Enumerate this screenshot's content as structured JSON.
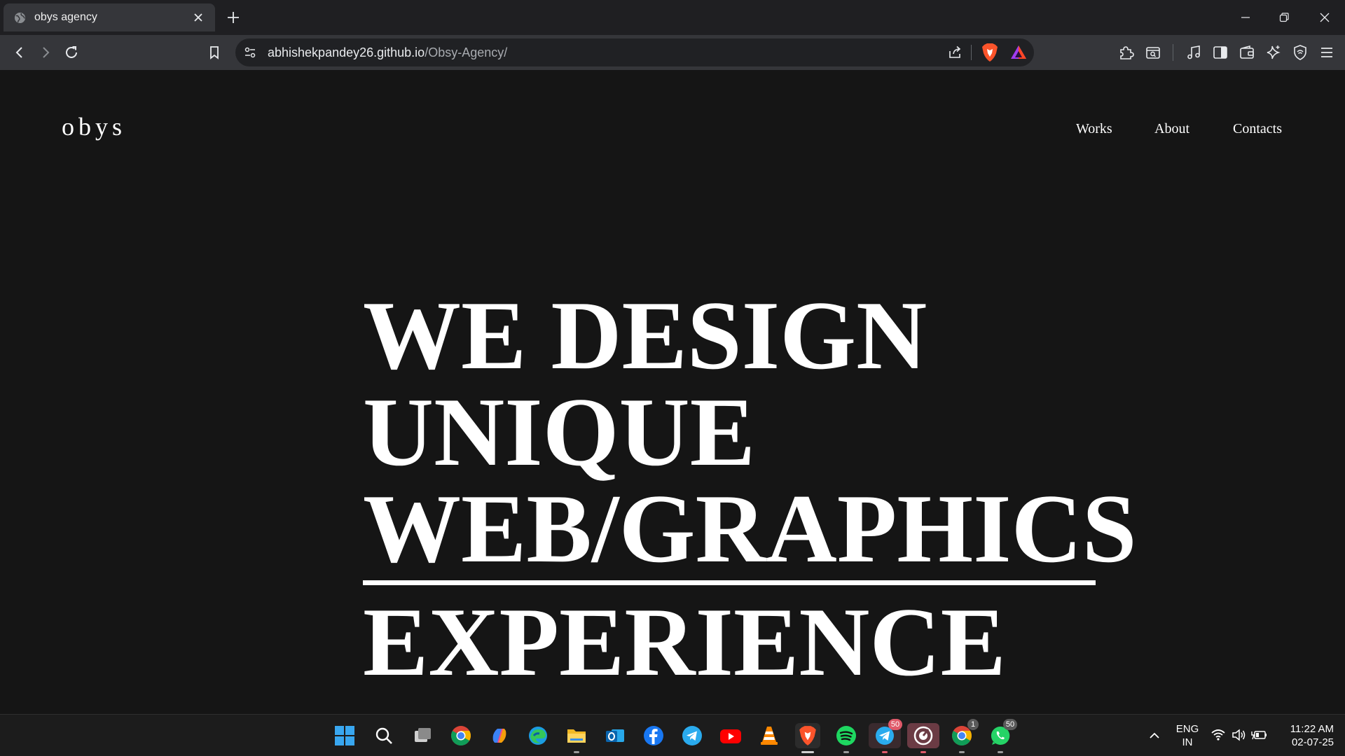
{
  "browser": {
    "tab_title": "obys agency",
    "url_host": "abhishekpandey26.github.io",
    "url_path": "/Obsy-Agency/",
    "icons": [
      "globe-icon",
      "close-icon",
      "plus-icon",
      "minimize-icon",
      "restore-icon",
      "window-close-icon",
      "back-icon",
      "forward-icon",
      "reload-icon",
      "bookmark-icon",
      "site-settings-icon",
      "share-icon",
      "brave-shields-icon",
      "brave-rewards-icon",
      "extensions-icon",
      "find-icon",
      "media-icon",
      "sidebar-icon",
      "wallet-icon",
      "leo-ai-icon",
      "vpn-icon",
      "menu-icon"
    ]
  },
  "site": {
    "logo": "obys",
    "nav": [
      "Works",
      "About",
      "Contacts"
    ],
    "hero": [
      "WE DESIGN",
      "UNIQUE",
      "WEB/GRAPHICS",
      "EXPERIENCE"
    ]
  },
  "taskbar": {
    "apps": [
      "start",
      "search",
      "task-view",
      "chrome",
      "copilot",
      "edge",
      "file-explorer",
      "outlook",
      "facebook",
      "telegram",
      "youtube",
      "vlc",
      "brave",
      "spotify",
      "telegram-desktop",
      "davinci",
      "chrome-profile",
      "whatsapp"
    ],
    "telegram_badge": "50",
    "whatsapp_badge": "50",
    "chrome_badge": "1",
    "lang_top": "ENG",
    "lang_bottom": "IN",
    "time": "11:22 AM",
    "date": "02-07-25"
  },
  "colors": {
    "page_bg": "#151515",
    "text": "#ffffff",
    "chrome_bg": "#35363a",
    "tabstrip_bg": "#1f1f22"
  }
}
